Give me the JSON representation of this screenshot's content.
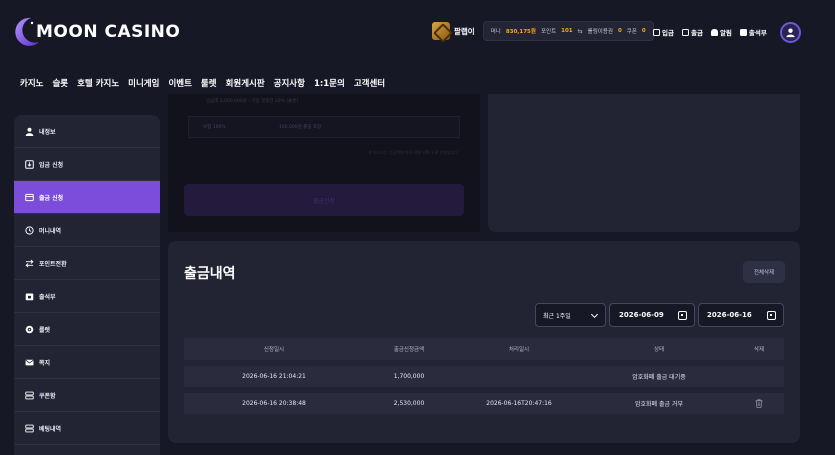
{
  "header": {
    "logo_text": "MOON CASINO",
    "username": "팔랩이",
    "money_label": "머니",
    "money_value": "830,175원",
    "point_label": "포인트",
    "point_value": "101",
    "rolling_label": "롤링이용권",
    "rolling_value": "0",
    "coupon_label": "쿠폰",
    "coupon_value": "0",
    "links": [
      "입금",
      "출금",
      "알림",
      "출석부"
    ]
  },
  "nav": [
    "카지노",
    "슬롯",
    "호텔 카지노",
    "미니게임",
    "이벤트",
    "룰렛",
    "회원게시판",
    "공지사항",
    "1:1문의",
    "고객센터"
  ],
  "sidebar": {
    "items": [
      {
        "label": "내정보",
        "icon": "user-icon"
      },
      {
        "label": "입금 신청",
        "icon": "deposit-icon"
      },
      {
        "label": "출금 신청",
        "icon": "withdraw-icon",
        "active": true
      },
      {
        "label": "머니내역",
        "icon": "clock-icon"
      },
      {
        "label": "포인트전환",
        "icon": "exchange-icon"
      },
      {
        "label": "출석부",
        "icon": "calendar-icon"
      },
      {
        "label": "룰렛",
        "icon": "roulette-icon"
      },
      {
        "label": "쪽지",
        "icon": "mail-icon"
      },
      {
        "label": "쿠폰함",
        "icon": "coupon-icon"
      },
      {
        "label": "베팅내역",
        "icon": "list-icon"
      }
    ]
  },
  "deposit_remnant": {
    "row1": "입금액 2,000,000원 - 가입 첫충전 20% (슬롯)",
    "row2_a": "보험 100%",
    "row2_b": "100,000원 롤링 포함",
    "note": "※ 보너스는 입금액에 자동 적용 되며 1 회 한정됩니다",
    "button": "출금신청"
  },
  "history": {
    "title": "출금내역",
    "delete_all": "전체삭제",
    "period": "최근 1주일",
    "date_from": "2026-06-09",
    "date_to": "2026-06-16",
    "columns": [
      "신청일시",
      "출금신청금액",
      "처리일시",
      "상태",
      "삭제"
    ],
    "rows": [
      {
        "requested_at": "2026-06-16 21:04:21",
        "amount": "1,700,000",
        "processed_at": "",
        "status": "암호화폐 출금 대기중",
        "deletable": false
      },
      {
        "requested_at": "2026-06-16 20:38:48",
        "amount": "2,530,000",
        "processed_at": "2026-06-16T20:47:16",
        "status": "암호화폐 출금 거부",
        "deletable": true
      }
    ]
  },
  "colors": {
    "accent": "#7c4ddb",
    "background": "#161826",
    "card": "#222434",
    "money": "#f5a623"
  }
}
